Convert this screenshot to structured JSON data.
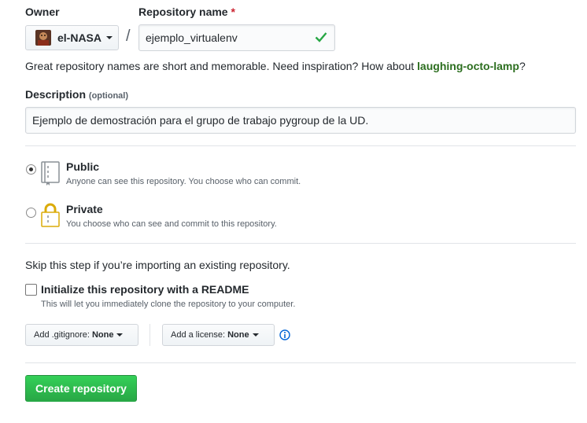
{
  "owner": {
    "label": "Owner",
    "name": "el-NASA",
    "avatar_icon": "avatar-icon"
  },
  "repo": {
    "label": "Repository name",
    "required_mark": "*",
    "separator": "/",
    "value": "ejemplo_virtualenv",
    "valid_icon": "check-icon"
  },
  "hint": {
    "text": "Great repository names are short and memorable. Need inspiration? How about ",
    "suggestion": "laughing-octo-lamp",
    "end": "?"
  },
  "description": {
    "label": "Description",
    "optional": "(optional)",
    "value": "Ejemplo de demostración para el grupo de trabajo pygroup de la UD."
  },
  "visibility": {
    "selected": "public",
    "public": {
      "title": "Public",
      "desc": "Anyone can see this repository. You choose who can commit.",
      "icon": "repo-book-icon"
    },
    "private": {
      "title": "Private",
      "desc": "You choose who can see and commit to this repository.",
      "icon": "lock-icon"
    }
  },
  "init": {
    "skip_text": "Skip this step if you’re importing an existing repository.",
    "readme_label": "Initialize this repository with a README",
    "readme_desc": "This will let you immediately clone the repository to your computer.",
    "readme_checked": false
  },
  "gitignore": {
    "label": "Add .gitignore:",
    "value": "None"
  },
  "license": {
    "label": "Add a license:",
    "value": "None",
    "info_icon": "info-icon"
  },
  "submit": {
    "label": "Create repository"
  },
  "colors": {
    "accent_green": "#28a745",
    "suggestion_green": "#2c6e1f",
    "required_red": "#cb2431"
  }
}
